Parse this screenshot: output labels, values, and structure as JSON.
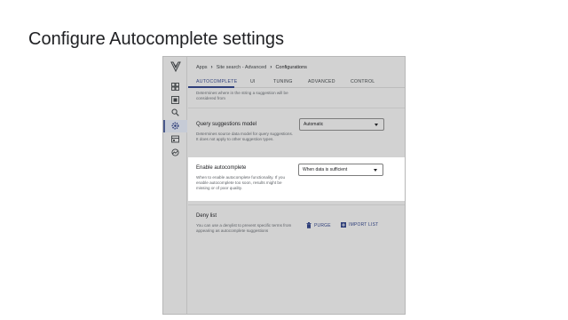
{
  "slide": {
    "title": "Configure Autocomplete settings"
  },
  "breadcrumb": {
    "apps": "Apps",
    "search_app": "Site search - Advanced",
    "current": "Configurations"
  },
  "tabs": [
    {
      "label": "AUTOCOMPLETE",
      "active": true
    },
    {
      "label": "UI",
      "active": false
    },
    {
      "label": "TUNING",
      "active": false
    },
    {
      "label": "ADVANCED",
      "active": false
    },
    {
      "label": "CONTROL",
      "active": false
    }
  ],
  "sidebar": {
    "icons": [
      "dashboard-icon",
      "data-icon",
      "search-icon",
      "settings-icon",
      "integration-icon",
      "analytics-icon"
    ],
    "active": "settings-icon"
  },
  "settings": {
    "previous_desc": "Determines where in the string a suggestion will be considered from",
    "query_model": {
      "title": "Query suggestions model",
      "desc": "Determines source data model for query suggestions. It does not apply to other suggestion types.",
      "value": "Automatic"
    },
    "enable": {
      "title": "Enable autocomplete",
      "desc": "When to enable autocomplete functionality. If you enable autocomplete too soon, results might be missing or of poor quality.",
      "value": "When data is sufficient"
    },
    "deny_list": {
      "title": "Deny list",
      "desc": "You can use a denylist to prevent specific terms from appearing as autocomplete suggestions",
      "purge_label": "PURGE",
      "import_label": "IMPORT LIST"
    }
  },
  "colors": {
    "accent": "#2f3f7a",
    "panel": "#d2d2d2",
    "highlight": "#ffffff"
  }
}
